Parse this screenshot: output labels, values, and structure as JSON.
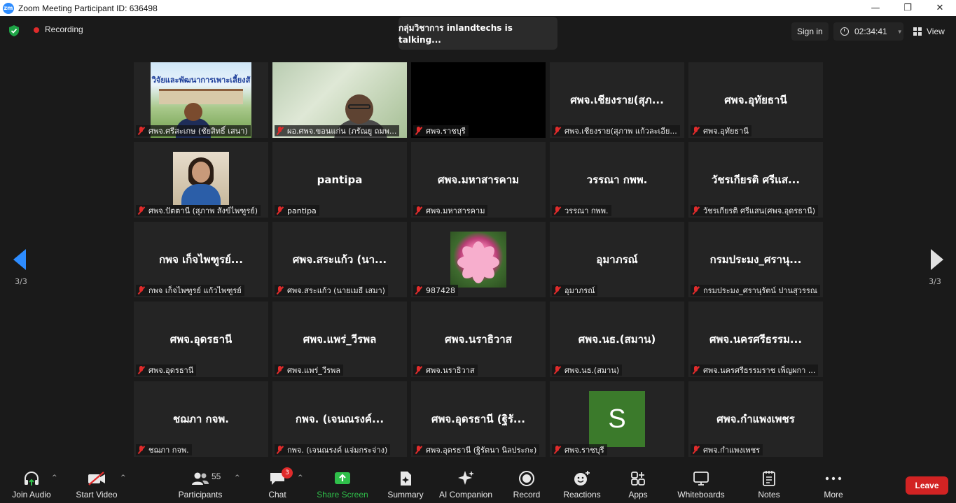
{
  "window": {
    "title": "Zoom Meeting Participant ID: 636498",
    "logo_text": "zm"
  },
  "topbar": {
    "recording_label": "Recording",
    "talking_text": "กลุ่มวิชาการ inlandtechs  is  talking...",
    "signin_label": "Sign in",
    "timer": "02:34:41",
    "view_label": "View"
  },
  "nav": {
    "page_left": "3/3",
    "page_right": "3/3"
  },
  "tiles": [
    {
      "name": "ศพจ.ศรีสะเกษ (ชัยสิทธิ์  เสนา)",
      "display": "",
      "type": "video-banner",
      "banner": "วิจัยและพัฒนาการเพาะเลี้ยงสั"
    },
    {
      "name": "ผอ.ศพจ.ขอนแก่น (ภรัณยู  ถมพ...",
      "display": "",
      "type": "video-green"
    },
    {
      "name": "ศพจ.ราชบุรี",
      "display": "",
      "type": "video-black"
    },
    {
      "name": "ศพจ.เชียงราย(สุภาพ  แก้วละเอีย...",
      "display": "ศพจ.เชียงราย(สุภ...",
      "type": "name"
    },
    {
      "name": "ศพจ.อุทัยธานี",
      "display": "ศพจ.อุทัยธานี",
      "type": "name"
    },
    {
      "name": "ศพจ.ปัตตานี (สุภาพ สังข์ไพฑูรย์)",
      "display": "",
      "type": "video-woman"
    },
    {
      "name": "pantipa",
      "display": "pantipa",
      "type": "name"
    },
    {
      "name": "ศพจ.มหาสารคาม",
      "display": "ศพจ.มหาสารคาม",
      "type": "name"
    },
    {
      "name": "วรรณา กพพ.",
      "display": "วรรณา กพพ.",
      "type": "name"
    },
    {
      "name": "วัชรเกียรติ ศรีแสน(ศพจ.อุดรธานี)",
      "display": "วัชรเกียรติ ศรีแส...",
      "type": "name"
    },
    {
      "name": "กพจ เก็จไพฑูรย์ แก้วไพฑูรย์",
      "display": "กพจ เก็จไพฑูรย์...",
      "type": "name"
    },
    {
      "name": "ศพจ.สระแก้ว (นายเมธี เสมา)",
      "display": "ศพจ.สระแก้ว (นา...",
      "type": "name"
    },
    {
      "name": "987428",
      "display": "",
      "type": "video-flower"
    },
    {
      "name": "อุมาภรณ์",
      "display": "อุมาภรณ์",
      "type": "name"
    },
    {
      "name": "กรมประมง_ศรานุรัตน์ ปานสุวรรณ",
      "display": "กรมประมง_ศรานุ...",
      "type": "name"
    },
    {
      "name": "ศพจ.อุดรธานี",
      "display": "ศพจ.อุดรธานี",
      "type": "name"
    },
    {
      "name": "ศพจ.แพร่_วีรพล",
      "display": "ศพจ.แพร่_วีรพล",
      "type": "name"
    },
    {
      "name": "ศพจ.นราธิวาส",
      "display": "ศพจ.นราธิวาส",
      "type": "name"
    },
    {
      "name": "ศพจ.นธ.(สมาน)",
      "display": "ศพจ.นธ.(สมาน)",
      "type": "name"
    },
    {
      "name": "ศพจ.นครศรีธรรมราช เพ็ญผกา ...",
      "display": "ศพจ.นครศรีธรรม...",
      "type": "name"
    },
    {
      "name": "ชฌภา กจพ.",
      "display": "ชฌภา กจพ.",
      "type": "name"
    },
    {
      "name": "กพจ. (เจนณรงค์ แจ่มกระจ่าง)",
      "display": "กพจ. (เจนณรงค์...",
      "type": "name"
    },
    {
      "name": "ศพจ.อุดรธานี (ฐิรัตนา นิลประกะ)",
      "display": "ศพจ.อุดรธานี (ฐิรั...",
      "type": "name"
    },
    {
      "name": "ศพจ.ราชบุรี",
      "display": "",
      "type": "avatar",
      "initial": "S"
    },
    {
      "name": "ศพจ.กำแพงเพชร",
      "display": "ศพจ.กำแพงเพชร",
      "type": "name"
    }
  ],
  "toolbar": {
    "join_audio": "Join Audio",
    "start_video": "Start Video",
    "participants": "Participants",
    "participants_count": "55",
    "chat": "Chat",
    "chat_badge": "3",
    "share_screen": "Share Screen",
    "summary": "Summary",
    "ai_companion": "AI Companion",
    "record": "Record",
    "reactions": "Reactions",
    "apps": "Apps",
    "whiteboards": "Whiteboards",
    "notes": "Notes",
    "more": "More",
    "leave": "Leave"
  },
  "colors": {
    "accent": "#2d8cff",
    "share_green": "#2fbf4a",
    "leave_red": "#d22323",
    "muted_red": "#e02b2b"
  }
}
